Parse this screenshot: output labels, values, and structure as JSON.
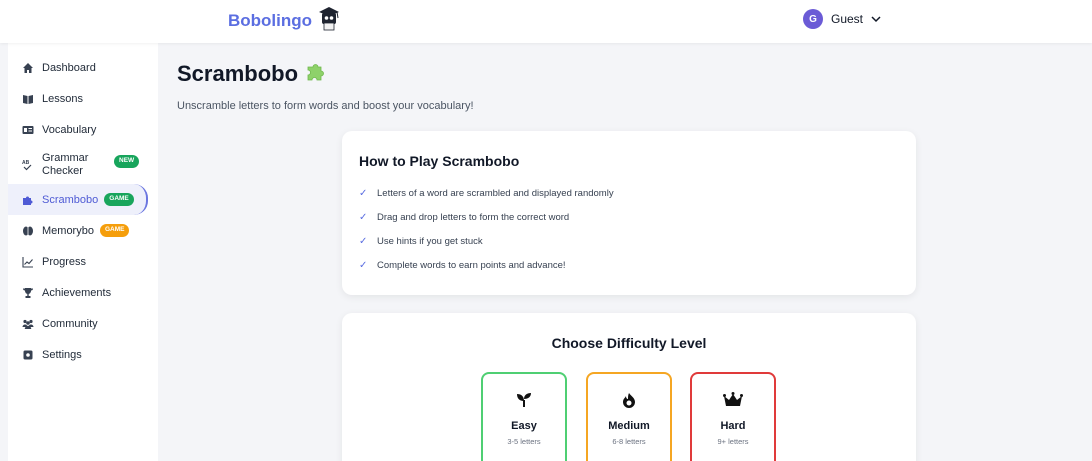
{
  "header": {
    "brand": "Bobolingo",
    "user_initial": "G",
    "user_name": "Guest"
  },
  "sidebar": {
    "items": [
      {
        "label": "Dashboard",
        "icon": "home-icon"
      },
      {
        "label": "Lessons",
        "icon": "book-icon"
      },
      {
        "label": "Vocabulary",
        "icon": "id-card-icon"
      },
      {
        "label": "Grammar Checker",
        "icon": "spell-check-icon",
        "badge": "NEW"
      },
      {
        "label": "Scrambobo",
        "icon": "puzzle-icon",
        "badge": "GAME",
        "active": true
      },
      {
        "label": "Memorybo",
        "icon": "brain-icon",
        "badge": "GAME"
      },
      {
        "label": "Progress",
        "icon": "line-chart-icon"
      },
      {
        "label": "Achievements",
        "icon": "trophy-icon"
      },
      {
        "label": "Community",
        "icon": "users-icon"
      },
      {
        "label": "Settings",
        "icon": "gear-icon"
      }
    ],
    "grammar_line1": "Grammar",
    "grammar_line2": "Checker"
  },
  "main": {
    "title": "Scrambobo",
    "subtitle": "Unscramble letters to form words and boost your vocabulary!",
    "how_to": {
      "title": "How to Play Scrambobo",
      "check_glyph": "✓",
      "rules": [
        "Letters of a word are scrambled and displayed randomly",
        "Drag and drop letters to form the correct word",
        "Use hints if you get stuck",
        "Complete words to earn points and advance!"
      ]
    },
    "difficulty": {
      "title": "Choose Difficulty Level",
      "levels": [
        {
          "name": "Easy",
          "desc": "3-5 letters",
          "icon": "seedling-icon",
          "color": "#4fcf73"
        },
        {
          "name": "Medium",
          "desc": "6-8 letters",
          "icon": "fire-icon",
          "color": "#f5a623"
        },
        {
          "name": "Hard",
          "desc": "9+ letters",
          "icon": "crown-icon",
          "color": "#e03a3a"
        }
      ]
    }
  },
  "colors": {
    "accent": "#5b6ee1",
    "avatar": "#6b5bd6",
    "badge_green": "#18a55c",
    "badge_orange": "#f59e0b"
  }
}
